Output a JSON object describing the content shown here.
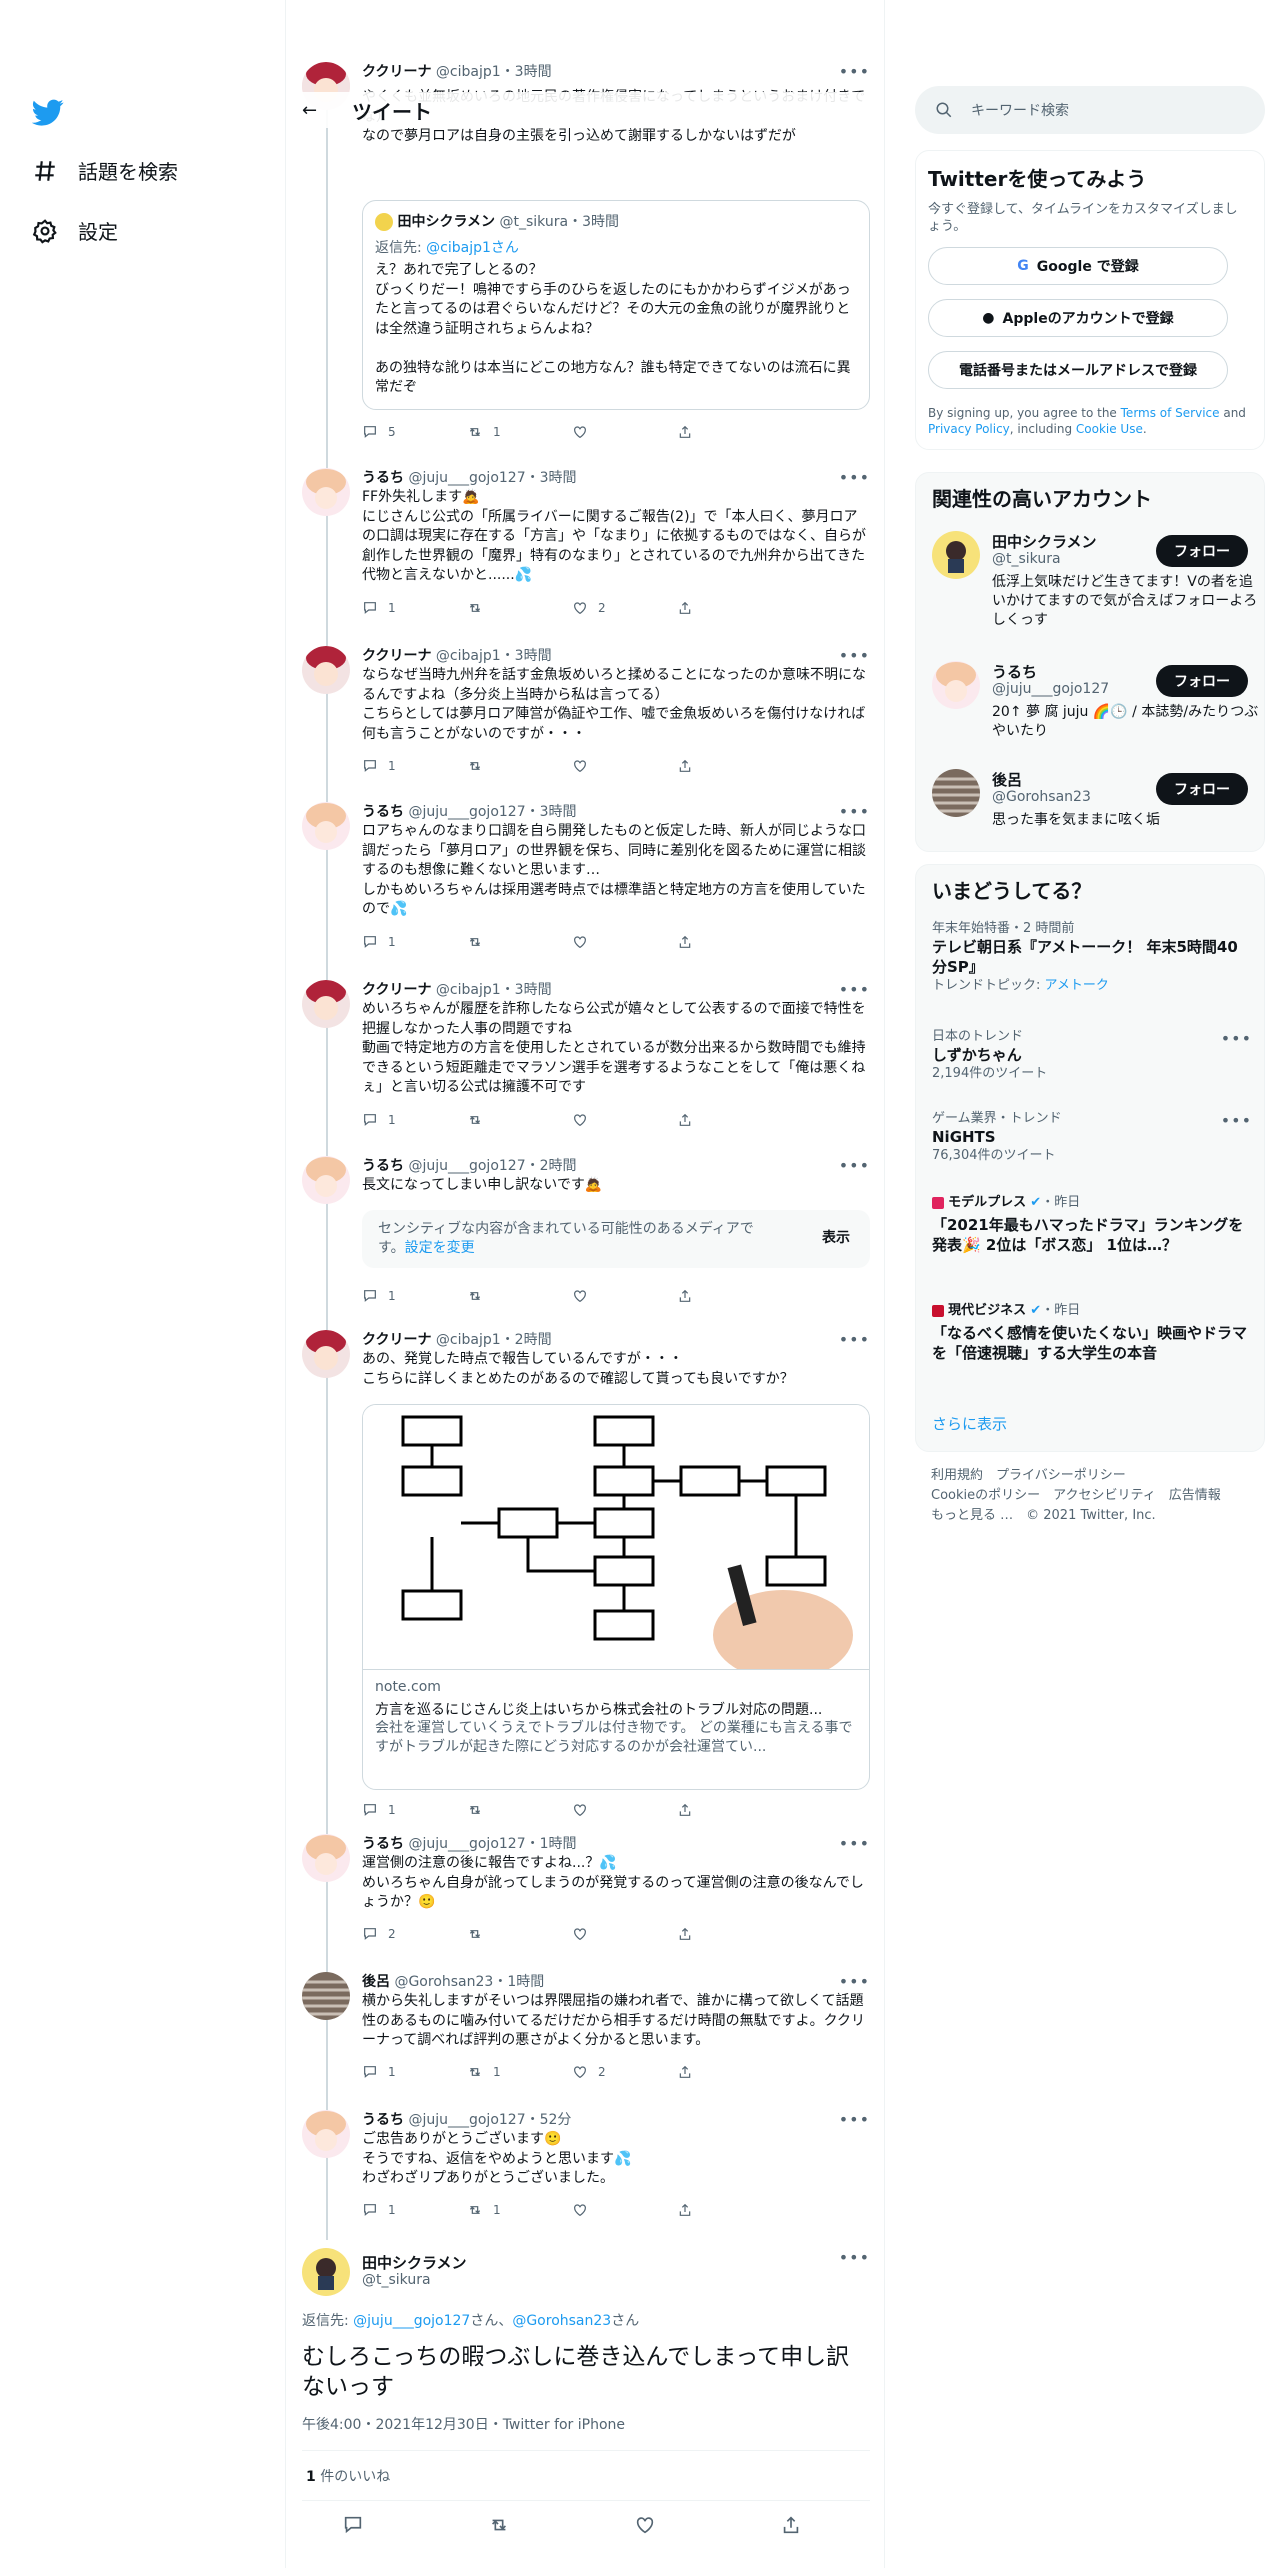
{
  "nav": {
    "explore": "話題を検索",
    "settings": "設定"
  },
  "header": {
    "title": "ツイート"
  },
  "tweets": [
    {
      "name": "ククリーナ",
      "handle": "@cibajp1",
      "time": "3時間",
      "body": "やくくも並無坂めいろの地元民の著作権侵害になってしまうというおまけ付きでな）\nなので夢月ロアは自身の主張を引っ込めて謝罪するしかないはずだが"
    },
    {
      "name": "うるち",
      "handle": "@juju___gojo127",
      "time": "3時間",
      "body": "FF外失礼します🙇\nにじさんじ公式の「所属ライバーに関するご報告(2)」で「本人曰く、夢月ロアの口調は現実に存在する「方言」や「なまり」に依拠するものではなく、自らが創作した世界観の「魔界」特有のなまり」とされているので九州弁から出てきた代物と言えないかと......💦",
      "reply": "1",
      "retweet": "",
      "like": "2"
    },
    {
      "name": "ククリーナ",
      "handle": "@cibajp1",
      "time": "3時間",
      "body": "ならなぜ当時九州弁を話す金魚坂めいろと揉めることになったのか意味不明になるんですよね（多分炎上当時から私は言ってる）\nこちらとしては夢月ロア陣営が偽証や工作、嘘で金魚坂めいろを傷付けなければ何も言うことがないのですが・・・",
      "reply": "1",
      "retweet": "",
      "like": ""
    },
    {
      "name": "うるち",
      "handle": "@juju___gojo127",
      "time": "3時間",
      "body": "ロアちゃんのなまり口調を自ら開発したものと仮定した時、新人が同じような口調だったら「夢月ロア」の世界観を保ち、同時に差別化を図るために運営に相談するのも想像に難くないと思います…\nしかもめいろちゃんは採用選考時点では標準語と特定地方の方言を使用していたので💦",
      "reply": "1",
      "retweet": "",
      "like": ""
    },
    {
      "name": "ククリーナ",
      "handle": "@cibajp1",
      "time": "3時間",
      "body": "めいろちゃんが履歴を詐称したなら公式が嬉々として公表するので面接で特性を把握しなかった人事の問題ですね\n動画で特定地方の方言を使用したとされているが数分出来るから数時間でも維持できるという短距離走でマラソン選手を選考するようなことをして「俺は悪くねぇ」と言い切る公式は擁護不可です",
      "reply": "1",
      "retweet": "",
      "like": ""
    },
    {
      "name": "うるち",
      "handle": "@juju___gojo127",
      "time": "2時間",
      "body": "長文になってしまい申し訳ないです🙇",
      "reply": "1",
      "retweet": "",
      "like": ""
    },
    {
      "name": "ククリーナ",
      "handle": "@cibajp1",
      "time": "2時間",
      "body": "あの、発覚した時点で報告しているんですが・・・\nこちらに詳しくまとめたのがあるので確認して貰っても良いですか？",
      "reply": "1",
      "retweet": "",
      "like": ""
    },
    {
      "name": "うるち",
      "handle": "@juju___gojo127",
      "time": "1時間",
      "body": "運営側の注意の後に報告ですよね...？💦\nめいろちゃん自身が訛ってしまうのが発覚するのって運営側の注意の後なんでしょうか？🙂",
      "reply": "2",
      "retweet": "",
      "like": ""
    },
    {
      "name": "後呂",
      "handle": "@Gorohsan23",
      "time": "1時間",
      "body": "横から失礼しますがそいつは界隈屈指の嫌われ者で、誰かに構って欲しくて話題性のあるものに噛み付いてるだけだから相手するだけ時間の無駄ですよ。ククリーナって調べれば評判の悪さがよく分かると思います。",
      "reply": "1",
      "retweet": "1",
      "like": "2"
    },
    {
      "name": "うるち",
      "handle": "@juju___gojo127",
      "time": "52分",
      "body": "ご忠告ありがとうございます🙂\nそうですね、返信をやめようと思います💦\nわざわざリプありがとうございました。",
      "reply": "1",
      "retweet": "1",
      "like": ""
    }
  ],
  "first_actions": {
    "reply": "5",
    "retweet": "1",
    "like": ""
  },
  "quote": {
    "name": "田中シクラメン",
    "handle": "@t_sikura",
    "time": "3時間",
    "reply_to_prefix": "返信先: ",
    "reply_to": "@cibajp1さん",
    "body": "え？あれで完了しとるの？\nびっくりだー！鳴神ですら手のひらを返したのにもかかわらずイジメがあったと言ってるのは君ぐらいなんだけど？その大元の金魚の訛りが魔界訛りとは全然違う証明されちょらんよね？\n\nあの独特な訛りは本当にどこの地方なん？誰も特定できてないのは流石に異常だぞ"
  },
  "sensitive": {
    "text": "センシティブな内容が含まれている可能性のあるメディアです。",
    "link": "設定を変更",
    "show": "表示"
  },
  "card": {
    "domain": "note.com",
    "title": "方言を巡るにじさんじ炎上はいちから株式会社のトラブル対応の問題...",
    "desc": "会社を運営していくうえでトラブルは付き物です。 どの業種にも言える事ですがトラブルが起きた際にどう対応するのかが会社運営てい..."
  },
  "main": {
    "name": "田中シクラメン",
    "handle": "@t_sikura",
    "reply_prefix": "返信先: ",
    "reply_to_1": "@juju___gojo127",
    "reply_mid": "さん、",
    "reply_to_2": "@Gorohsan23",
    "reply_suffix": "さん",
    "body": "むしろこっちの暇つぶしに巻き込んでしまって申し訳ないっす",
    "meta": "午後4:00・2021年12月30日・Twitter for iPhone",
    "likes_count": "1",
    "likes_label": " 件のいいね"
  },
  "sidebar": {
    "search_placeholder": "キーワード検索",
    "signup": {
      "title": "Twitterを使ってみよう",
      "subtitle": "今すぐ登録して、タイムラインをカスタマイズしましょう。",
      "google": "Google で登録",
      "apple": "Appleのアカウントで登録",
      "phone": "電話番号またはメールアドレスで登録",
      "terms_pre": "By signing up, you agree to the ",
      "terms": "Terms of Service",
      "and": " and ",
      "privacy": "Privacy Policy",
      "incl": ", including ",
      "cookie": "Cookie Use",
      "end": "."
    },
    "related": {
      "title": "関連性の高いアカウント",
      "follow": "フォロー",
      "accounts": [
        {
          "name": "田中シクラメン",
          "handle": "@t_sikura",
          "bio": "低浮上気味だけど生きてます！Vの者を追いかけてますので気が合えばフォローよろしくっす"
        },
        {
          "name": "うるち",
          "handle": "@juju___gojo127",
          "bio": "20↑ 夢 腐 juju 🌈🕒 / 本誌勢/みたりつぶやいたり"
        },
        {
          "name": "後呂",
          "handle": "@Gorohsan23",
          "bio": "思った事を気ままに呟く垢"
        }
      ]
    },
    "trends": {
      "title": "いまどうしてる？",
      "items": [
        {
          "meta": "年末年始特番・2 時間前",
          "title": "テレビ朝日系『アメトーーク！ 年末5時間40分SP』",
          "sub_prefix": "トレンドトピック: ",
          "sub_link": "アメトーク"
        },
        {
          "meta": "日本のトレンド",
          "title": "しずかちゃん",
          "sub": "2,194件のツイート"
        },
        {
          "meta": "ゲーム業界・トレンド",
          "title": "NiGHTS",
          "sub": "76,304件のツイート"
        },
        {
          "source": "モデルプレス",
          "when": "・昨日",
          "title": "「2021年最もハマったドラマ」ランキングを発表🎉 2位は「ボス恋」 1位は…？"
        },
        {
          "source": "現代ビジネス",
          "when": "・昨日",
          "title": "「なるべく感情を使いたくない」映画やドラマを「倍速視聴」する大学生の本音"
        }
      ],
      "more": "さらに表示"
    },
    "footer": {
      "l1": "利用規約　プライバシーポリシー",
      "l2": "Cookieのポリシー　アクセシビリティ　広告情報",
      "l3": "もっと見る …　© 2021 Twitter, Inc."
    }
  },
  "colors": {
    "accent": "#1d9bf0",
    "text": "#0f1419",
    "muted": "#536471"
  }
}
